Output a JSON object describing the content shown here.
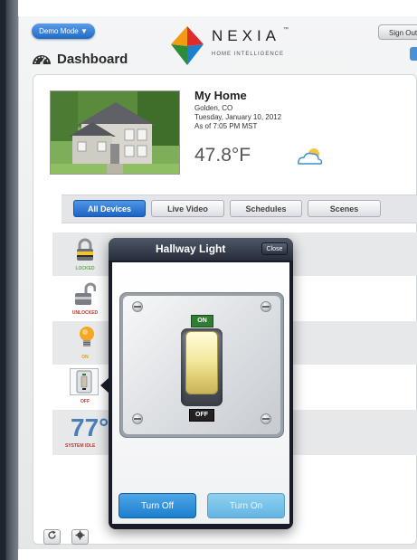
{
  "header": {
    "demo_mode_label": "Demo Mode ▼",
    "sign_out_label": "Sign Out",
    "dashboard_title": "Dashboard"
  },
  "logo": {
    "brand": "NEXIA",
    "tagline": "HOME INTELLIGENCE",
    "trademark": "™"
  },
  "home": {
    "name": "My Home",
    "location": "Golden, CO",
    "date": "Tuesday, January 10, 2012",
    "as_of": "As of 7:05 PM MST",
    "temperature": "47.8°F",
    "weather_icon": "partly-cloudy-icon"
  },
  "tabs": [
    {
      "label": "All Devices",
      "active": true
    },
    {
      "label": "Live Video",
      "active": false
    },
    {
      "label": "Schedules",
      "active": false
    },
    {
      "label": "Scenes",
      "active": false
    }
  ],
  "devices": [
    {
      "icon": "padlock-locked-icon",
      "status": "LOCKED",
      "status_color": "#6aa84f"
    },
    {
      "icon": "padlock-unlocked-icon",
      "status": "UNLOCKED",
      "status_color": "#c0392b"
    },
    {
      "icon": "light-bulb-icon",
      "status": "ON",
      "status_color": "#e0a000"
    },
    {
      "icon": "light-switch-icon",
      "status": "OFF",
      "status_color": "#c0392b"
    },
    {
      "icon": "thermostat-icon",
      "status": "SYSTEM IDLE",
      "status_color": "#c0392b",
      "temperature": "77°"
    }
  ],
  "modal": {
    "title": "Hallway Light",
    "close_label": "Close",
    "on_label": "ON",
    "off_label": "OFF",
    "turn_off_label": "Turn Off",
    "turn_on_label": "Turn On"
  },
  "colors": {
    "accent": "#1d64c3",
    "turn_off_button": "#1b7fcf",
    "turn_on_button": "#63b5e3"
  }
}
